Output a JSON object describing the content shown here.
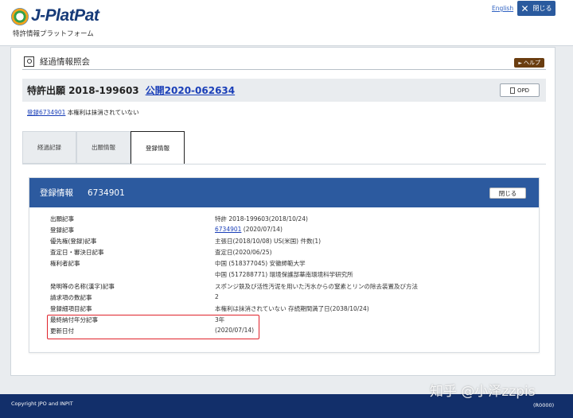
{
  "header": {
    "logo_text": "J-PlatPat",
    "logo_sub": "特許情報プラットフォーム",
    "lang_link": "English",
    "close_label": "閉じる"
  },
  "section": {
    "title": "経過情報照会",
    "help_label": "ヘルプ"
  },
  "application": {
    "number": "特許出願 2018-199603",
    "publication_link": "公開2020-062634",
    "opd_label": "OPD"
  },
  "reg_note": {
    "link": "登録6734901",
    "text": " 本権利は抹消されていない"
  },
  "tabs": [
    {
      "label": "経過記録",
      "active": false
    },
    {
      "label": "出願情報",
      "active": false
    },
    {
      "label": "登録情報",
      "active": true
    }
  ],
  "card": {
    "title": "登録情報",
    "reg_no": "6734901",
    "close_label": "閉じる",
    "rows": [
      {
        "key": "出願記事",
        "value": "特許 2018-199603(2018/10/24)"
      },
      {
        "key": "登録記事",
        "value_link": "6734901",
        "value": " (2020/07/14)"
      },
      {
        "key": "優先権(登録)記事",
        "value": "主張日(2018/10/08) US(米国) 件数(1)"
      },
      {
        "key": "査定日・審決日記事",
        "value": "査定日(2020/06/25)"
      },
      {
        "key": "権利者記事",
        "value": "中国 (518377045) 安徽師範大学"
      },
      {
        "key": "",
        "value": "中国 (517288771) 環境保護部華南環境科学研究所"
      },
      {
        "key": "発明等の名称(漢字)記事",
        "value": "スポンジ鉄及び活性汚泥を用いた汚水からの窒素とリンの除去装置及び方法"
      },
      {
        "key": "請求項の数記事",
        "value": "2"
      },
      {
        "key": "登録細項目記事",
        "value": "本権利は抹消されていない 存続期間満了日(2038/10/24)"
      },
      {
        "key": "最終納付年分記事",
        "value": "3年"
      },
      {
        "key": "更新日付",
        "value": "(2020/07/14)"
      }
    ]
  },
  "footer": {
    "copyright": "Copyright JPO and INPIT",
    "count": "(R0000)"
  },
  "watermark": "知乎 @小泽zzpis",
  "colors": {
    "brand_blue": "#2c5a9f",
    "footer_navy": "#122f6a",
    "link_blue": "#1a3fb8",
    "highlight_red": "#e0232b",
    "help_brown": "#6a3d10"
  }
}
